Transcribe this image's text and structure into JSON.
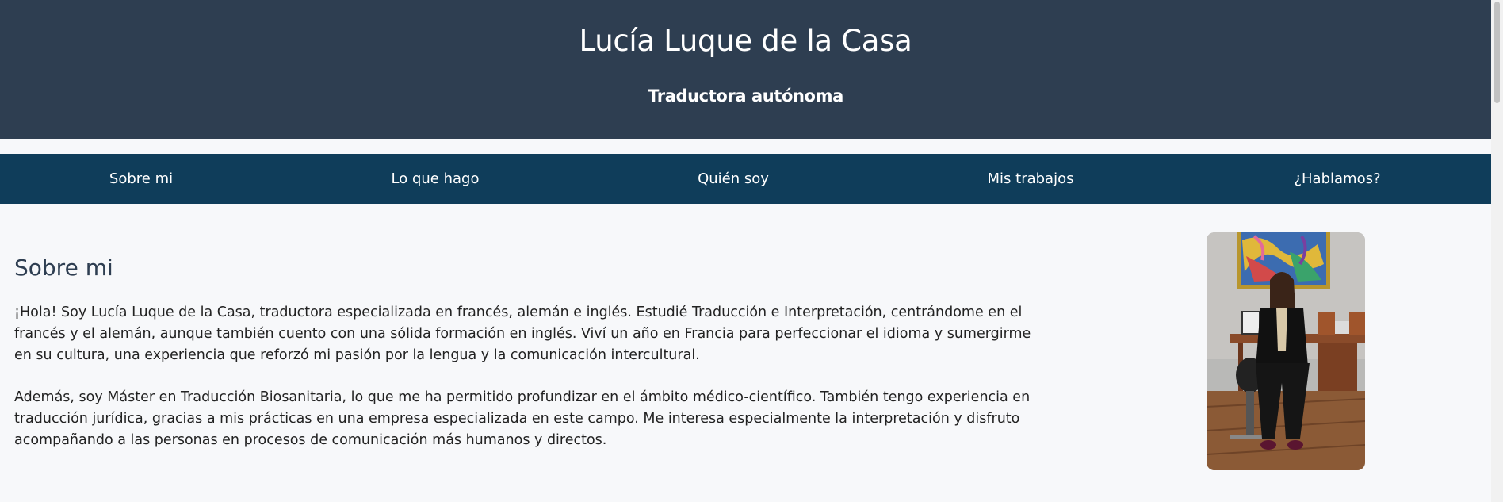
{
  "header": {
    "name": "Lucía Luque de la Casa",
    "subtitle": "Traductora autónoma"
  },
  "nav": {
    "items": [
      "Sobre mi",
      "Lo que hago",
      "Quién soy",
      "Mis trabajos",
      "¿Hablamos?"
    ]
  },
  "about": {
    "title": "Sobre mi",
    "paragraph1": "¡Hola! Soy Lucía Luque de la Casa, traductora especializada en francés, alemán e inglés. Estudié Traducción e Interpretación, centrándome en el francés y el alemán, aunque también cuento con una sólida formación en inglés. Viví un año en Francia para perfeccionar el idioma y sumergirme en su cultura, una experiencia que reforzó mi pasión por la lengua y la comunicación intercultural.",
    "paragraph2": "Además, soy Máster en Traducción Biosanitaria, lo que me ha permitido profundizar en el ámbito médico-científico. También tengo experiencia en traducción jurídica, gracias a mis prácticas en una empresa especializada en este campo. Me interesa especialmente la interpretación y disfruto acompañando a las personas en procesos de comunicación más humanos y directos."
  },
  "colors": {
    "header_bg": "#2e3e51",
    "nav_bg": "#0f3d5a",
    "page_bg": "#f7f8fa",
    "heading": "#2e3e51"
  }
}
